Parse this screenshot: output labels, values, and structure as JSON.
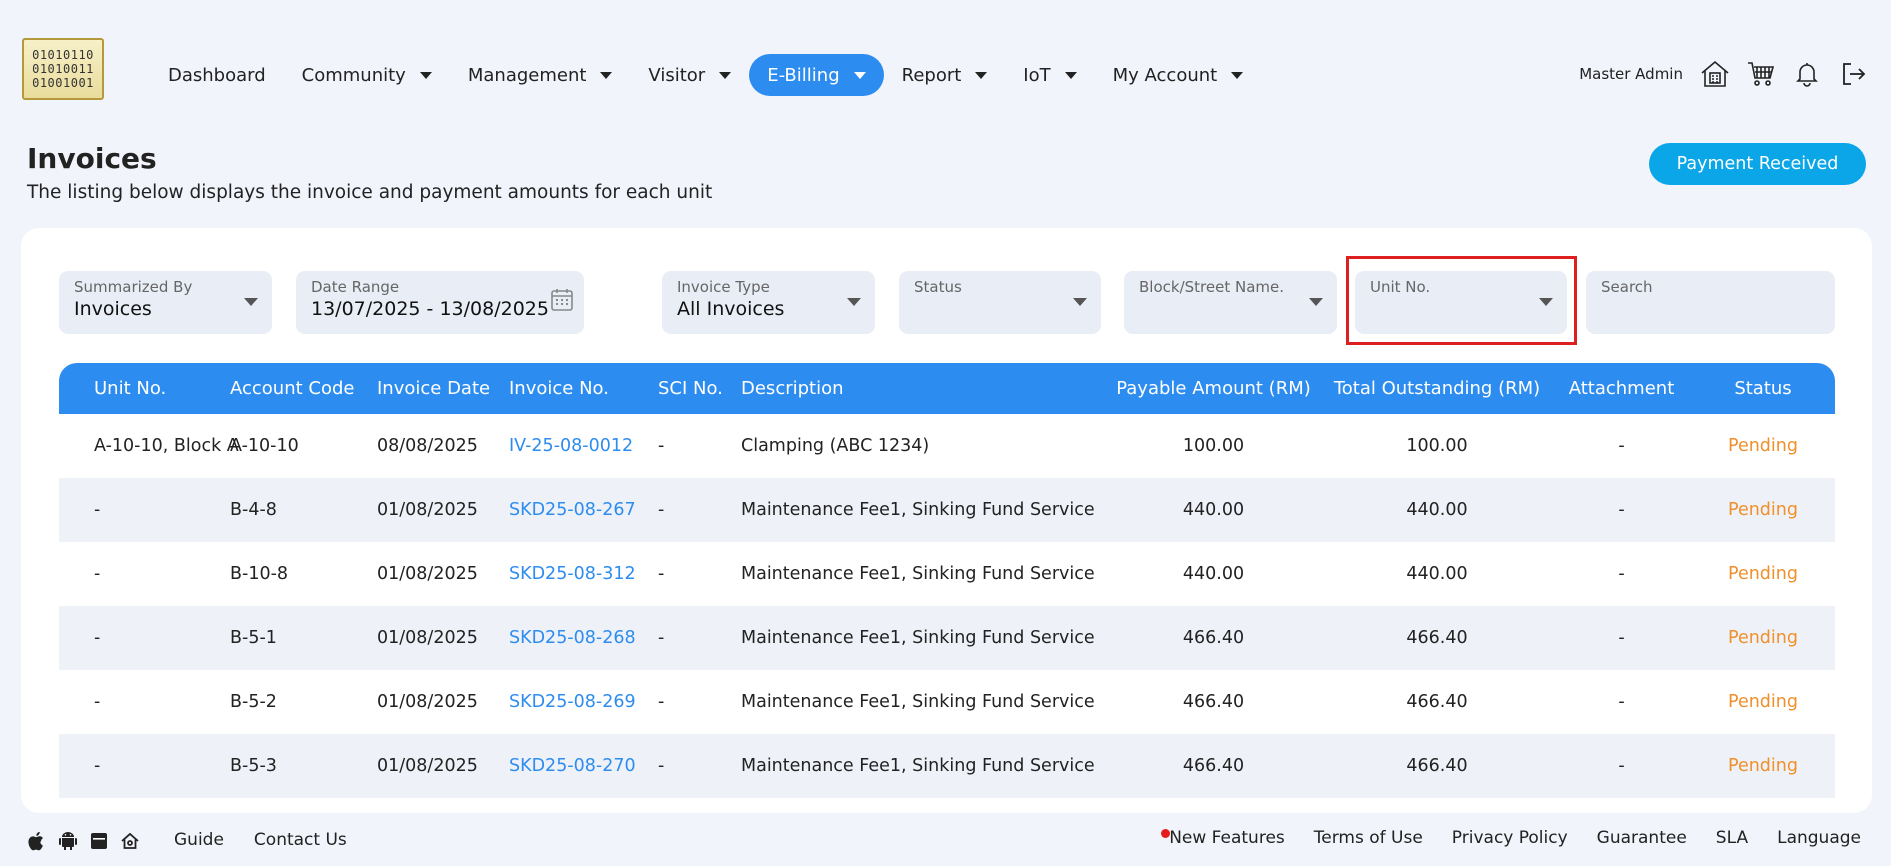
{
  "logo": {
    "lines": [
      "01010110",
      "01010011",
      "01001001"
    ]
  },
  "nav": {
    "items": [
      {
        "label": "Dashboard",
        "dropdown": false
      },
      {
        "label": "Community",
        "dropdown": true
      },
      {
        "label": "Management",
        "dropdown": true
      },
      {
        "label": "Visitor",
        "dropdown": true
      },
      {
        "label": "E-Billing",
        "dropdown": true,
        "active": true
      },
      {
        "label": "Report",
        "dropdown": true
      },
      {
        "label": "IoT",
        "dropdown": true
      },
      {
        "label": "My Account",
        "dropdown": true
      }
    ]
  },
  "header": {
    "user_name": "Master Admin",
    "icons": [
      "home-calculator-icon",
      "cart-icon",
      "bell-icon",
      "logout-icon"
    ]
  },
  "page": {
    "title": "Invoices",
    "subtitle": "The listing below displays the invoice and payment amounts for each unit",
    "action_button": "Payment Received"
  },
  "filters": {
    "summarized_by": {
      "label": "Summarized By",
      "value": "Invoices"
    },
    "date_range": {
      "label": "Date Range",
      "value": "13/07/2025 - 13/08/2025"
    },
    "invoice_type": {
      "label": "Invoice Type",
      "value": "All Invoices"
    },
    "status": {
      "label": "Status",
      "value": ""
    },
    "block": {
      "label": "Block/Street Name.",
      "value": ""
    },
    "unit_no": {
      "label": "Unit No.",
      "value": ""
    },
    "search": {
      "label": "Search",
      "value": ""
    }
  },
  "table": {
    "columns": [
      "Unit No.",
      "Account Code",
      "Invoice Date",
      "Invoice No.",
      "SCI No.",
      "Description",
      "Payable Amount (RM)",
      "Total Outstanding (RM)",
      "Attachment",
      "Status"
    ],
    "rows": [
      {
        "unit": "A-10-10, Block A",
        "account": "A-10-10",
        "date": "08/08/2025",
        "invoice": "IV-25-08-0012",
        "sci": "-",
        "desc": "Clamping (ABC 1234)",
        "payable": "100.00",
        "outstanding": "100.00",
        "attachment": "-",
        "status": "Pending"
      },
      {
        "unit": "-",
        "account": "B-4-8",
        "date": "01/08/2025",
        "invoice": "SKD25-08-267",
        "sci": "-",
        "desc": "Maintenance Fee1, Sinking Fund Service",
        "payable": "440.00",
        "outstanding": "440.00",
        "attachment": "-",
        "status": "Pending"
      },
      {
        "unit": "-",
        "account": "B-10-8",
        "date": "01/08/2025",
        "invoice": "SKD25-08-312",
        "sci": "-",
        "desc": "Maintenance Fee1, Sinking Fund Service",
        "payable": "440.00",
        "outstanding": "440.00",
        "attachment": "-",
        "status": "Pending"
      },
      {
        "unit": "-",
        "account": "B-5-1",
        "date": "01/08/2025",
        "invoice": "SKD25-08-268",
        "sci": "-",
        "desc": "Maintenance Fee1, Sinking Fund Service",
        "payable": "466.40",
        "outstanding": "466.40",
        "attachment": "-",
        "status": "Pending"
      },
      {
        "unit": "-",
        "account": "B-5-2",
        "date": "01/08/2025",
        "invoice": "SKD25-08-269",
        "sci": "-",
        "desc": "Maintenance Fee1, Sinking Fund Service",
        "payable": "466.40",
        "outstanding": "466.40",
        "attachment": "-",
        "status": "Pending"
      },
      {
        "unit": "-",
        "account": "B-5-3",
        "date": "01/08/2025",
        "invoice": "SKD25-08-270",
        "sci": "-",
        "desc": "Maintenance Fee1, Sinking Fund Service",
        "payable": "466.40",
        "outstanding": "466.40",
        "attachment": "-",
        "status": "Pending"
      }
    ]
  },
  "footer": {
    "platform_icons": [
      "apple-icon",
      "android-icon",
      "window-app-icon",
      "home-icon"
    ],
    "left_links": [
      "Guide",
      "Contact Us"
    ],
    "right_links": [
      "New Features",
      "Terms of Use",
      "Privacy Policy",
      "Guarantee",
      "SLA",
      "Language"
    ]
  },
  "colors": {
    "primary": "#2d8cf0",
    "action_button": "#0aa6e8",
    "pending": "#f0902a",
    "highlight": "#dd1f1f",
    "background": "#f1f4fa"
  }
}
